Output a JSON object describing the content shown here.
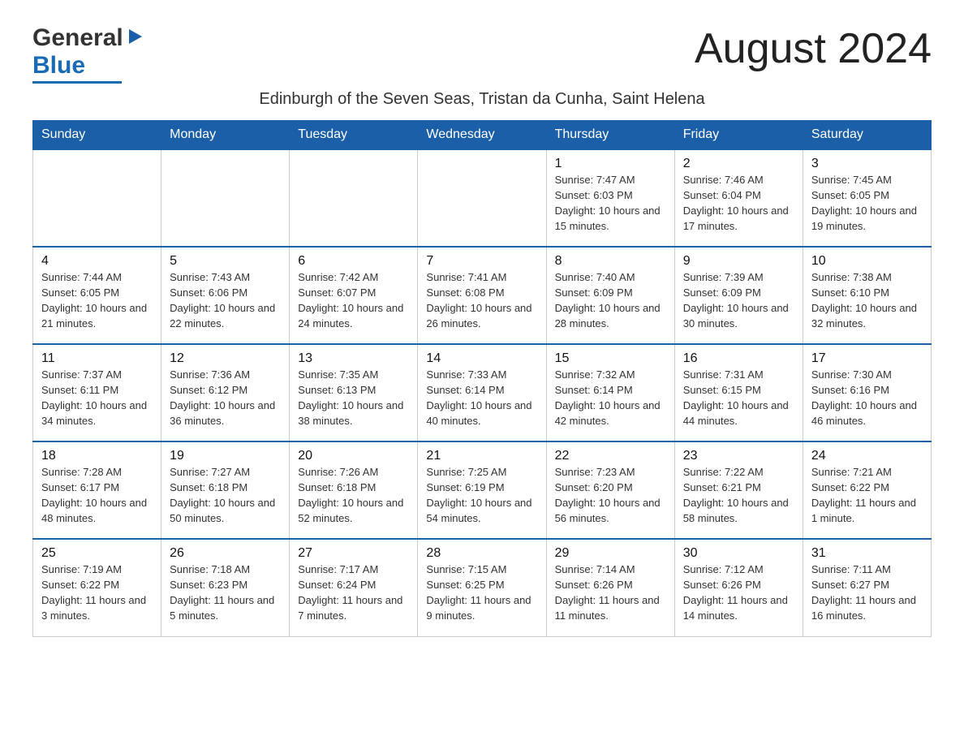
{
  "logo": {
    "general": "General",
    "blue": "Blue",
    "arrow": "▶"
  },
  "header": {
    "month_year": "August 2024",
    "location": "Edinburgh of the Seven Seas, Tristan da Cunha, Saint Helena"
  },
  "days_of_week": [
    "Sunday",
    "Monday",
    "Tuesday",
    "Wednesday",
    "Thursday",
    "Friday",
    "Saturday"
  ],
  "weeks": [
    {
      "cells": [
        {
          "day": "",
          "info": ""
        },
        {
          "day": "",
          "info": ""
        },
        {
          "day": "",
          "info": ""
        },
        {
          "day": "",
          "info": ""
        },
        {
          "day": "1",
          "info": "Sunrise: 7:47 AM\nSunset: 6:03 PM\nDaylight: 10 hours and 15 minutes."
        },
        {
          "day": "2",
          "info": "Sunrise: 7:46 AM\nSunset: 6:04 PM\nDaylight: 10 hours and 17 minutes."
        },
        {
          "day": "3",
          "info": "Sunrise: 7:45 AM\nSunset: 6:05 PM\nDaylight: 10 hours and 19 minutes."
        }
      ]
    },
    {
      "cells": [
        {
          "day": "4",
          "info": "Sunrise: 7:44 AM\nSunset: 6:05 PM\nDaylight: 10 hours and 21 minutes."
        },
        {
          "day": "5",
          "info": "Sunrise: 7:43 AM\nSunset: 6:06 PM\nDaylight: 10 hours and 22 minutes."
        },
        {
          "day": "6",
          "info": "Sunrise: 7:42 AM\nSunset: 6:07 PM\nDaylight: 10 hours and 24 minutes."
        },
        {
          "day": "7",
          "info": "Sunrise: 7:41 AM\nSunset: 6:08 PM\nDaylight: 10 hours and 26 minutes."
        },
        {
          "day": "8",
          "info": "Sunrise: 7:40 AM\nSunset: 6:09 PM\nDaylight: 10 hours and 28 minutes."
        },
        {
          "day": "9",
          "info": "Sunrise: 7:39 AM\nSunset: 6:09 PM\nDaylight: 10 hours and 30 minutes."
        },
        {
          "day": "10",
          "info": "Sunrise: 7:38 AM\nSunset: 6:10 PM\nDaylight: 10 hours and 32 minutes."
        }
      ]
    },
    {
      "cells": [
        {
          "day": "11",
          "info": "Sunrise: 7:37 AM\nSunset: 6:11 PM\nDaylight: 10 hours and 34 minutes."
        },
        {
          "day": "12",
          "info": "Sunrise: 7:36 AM\nSunset: 6:12 PM\nDaylight: 10 hours and 36 minutes."
        },
        {
          "day": "13",
          "info": "Sunrise: 7:35 AM\nSunset: 6:13 PM\nDaylight: 10 hours and 38 minutes."
        },
        {
          "day": "14",
          "info": "Sunrise: 7:33 AM\nSunset: 6:14 PM\nDaylight: 10 hours and 40 minutes."
        },
        {
          "day": "15",
          "info": "Sunrise: 7:32 AM\nSunset: 6:14 PM\nDaylight: 10 hours and 42 minutes."
        },
        {
          "day": "16",
          "info": "Sunrise: 7:31 AM\nSunset: 6:15 PM\nDaylight: 10 hours and 44 minutes."
        },
        {
          "day": "17",
          "info": "Sunrise: 7:30 AM\nSunset: 6:16 PM\nDaylight: 10 hours and 46 minutes."
        }
      ]
    },
    {
      "cells": [
        {
          "day": "18",
          "info": "Sunrise: 7:28 AM\nSunset: 6:17 PM\nDaylight: 10 hours and 48 minutes."
        },
        {
          "day": "19",
          "info": "Sunrise: 7:27 AM\nSunset: 6:18 PM\nDaylight: 10 hours and 50 minutes."
        },
        {
          "day": "20",
          "info": "Sunrise: 7:26 AM\nSunset: 6:18 PM\nDaylight: 10 hours and 52 minutes."
        },
        {
          "day": "21",
          "info": "Sunrise: 7:25 AM\nSunset: 6:19 PM\nDaylight: 10 hours and 54 minutes."
        },
        {
          "day": "22",
          "info": "Sunrise: 7:23 AM\nSunset: 6:20 PM\nDaylight: 10 hours and 56 minutes."
        },
        {
          "day": "23",
          "info": "Sunrise: 7:22 AM\nSunset: 6:21 PM\nDaylight: 10 hours and 58 minutes."
        },
        {
          "day": "24",
          "info": "Sunrise: 7:21 AM\nSunset: 6:22 PM\nDaylight: 11 hours and 1 minute."
        }
      ]
    },
    {
      "cells": [
        {
          "day": "25",
          "info": "Sunrise: 7:19 AM\nSunset: 6:22 PM\nDaylight: 11 hours and 3 minutes."
        },
        {
          "day": "26",
          "info": "Sunrise: 7:18 AM\nSunset: 6:23 PM\nDaylight: 11 hours and 5 minutes."
        },
        {
          "day": "27",
          "info": "Sunrise: 7:17 AM\nSunset: 6:24 PM\nDaylight: 11 hours and 7 minutes."
        },
        {
          "day": "28",
          "info": "Sunrise: 7:15 AM\nSunset: 6:25 PM\nDaylight: 11 hours and 9 minutes."
        },
        {
          "day": "29",
          "info": "Sunrise: 7:14 AM\nSunset: 6:26 PM\nDaylight: 11 hours and 11 minutes."
        },
        {
          "day": "30",
          "info": "Sunrise: 7:12 AM\nSunset: 6:26 PM\nDaylight: 11 hours and 14 minutes."
        },
        {
          "day": "31",
          "info": "Sunrise: 7:11 AM\nSunset: 6:27 PM\nDaylight: 11 hours and 16 minutes."
        }
      ]
    }
  ]
}
